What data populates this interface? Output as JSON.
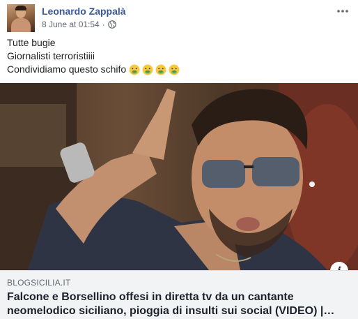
{
  "post": {
    "author": "Leonardo Zappalà",
    "timestamp": "8 June at 01:54",
    "separator": "·",
    "privacy_icon": "globe-icon",
    "menu_icon": "more-options-icon",
    "message_lines": [
      "Tutte bugie",
      "Giornalisti terroristiiii",
      "Condividiamo questo schifo"
    ],
    "emojis": [
      "nauseated-face",
      "nauseated-face",
      "nauseated-face",
      "nauseated-face"
    ]
  },
  "link_preview": {
    "domain": "BLOGSICILIA.IT",
    "title_line1": "Falcone e Borsellino offesi in diretta tv da un cantante",
    "title_line2": "neomelodico siciliano, pioggia di insulti sui social (VIDEO) |…",
    "info_label": "i"
  },
  "colors": {
    "author": "#385898",
    "meta": "#616770",
    "link_bg": "#f2f3f5",
    "emoji_face": "#f7c842",
    "emoji_mouth": "#7fb55a"
  }
}
